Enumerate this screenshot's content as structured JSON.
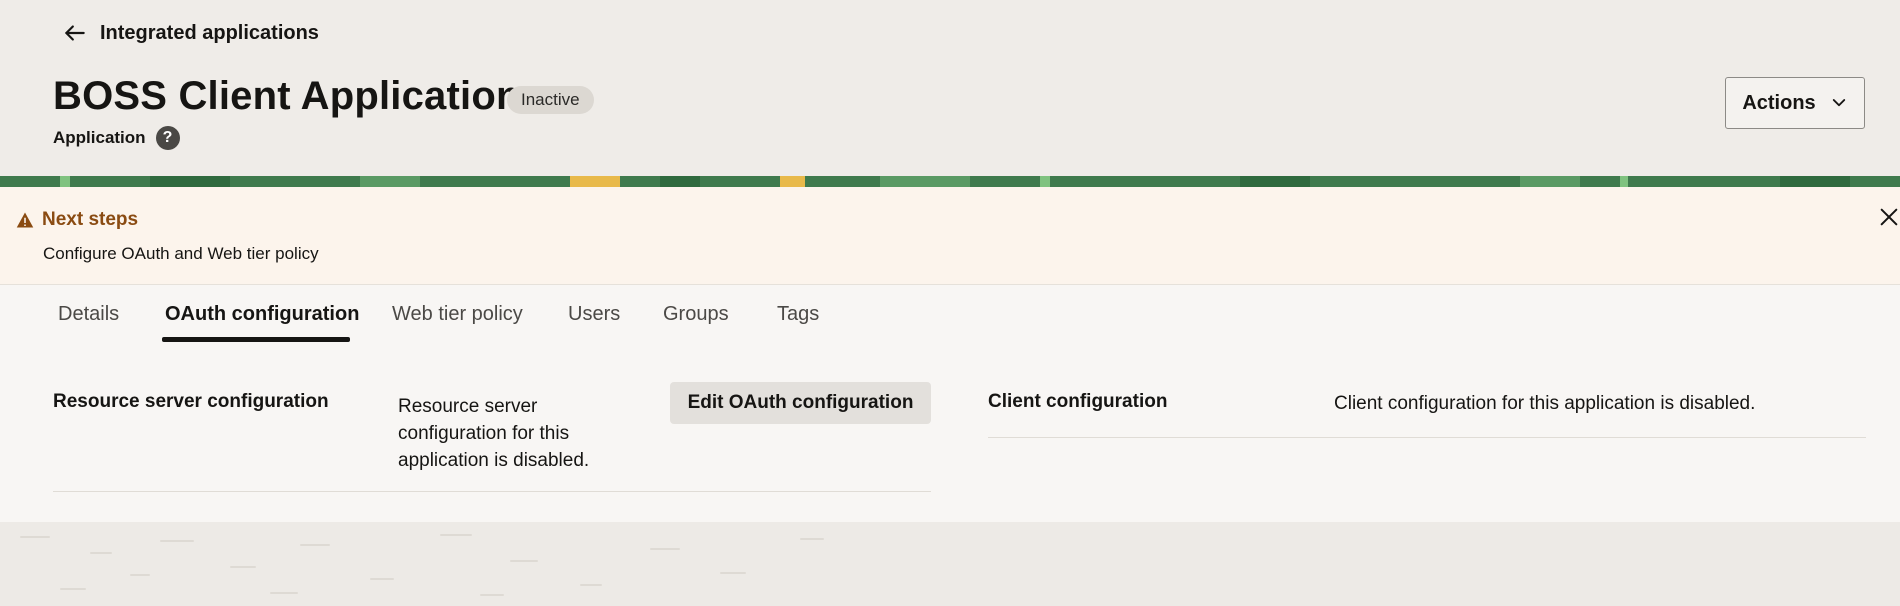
{
  "header": {
    "back_label": "Integrated applications",
    "title": "BOSS Client Application",
    "status_badge": "Inactive",
    "subtitle": "Application",
    "help_glyph": "?",
    "actions_label": "Actions"
  },
  "alert": {
    "title": "Next steps",
    "description": "Configure OAuth and Web tier policy",
    "icon": "warning-icon",
    "title_color": "#8a4b12"
  },
  "tabs": [
    {
      "label": "Details",
      "active": false
    },
    {
      "label": "OAuth configuration",
      "active": true
    },
    {
      "label": "Web tier policy",
      "active": false
    },
    {
      "label": "Users",
      "active": false
    },
    {
      "label": "Groups",
      "active": false
    },
    {
      "label": "Tags",
      "active": false
    }
  ],
  "oauth": {
    "resource_server_label": "Resource server configuration",
    "resource_server_value": "Resource server configuration for this application is disabled.",
    "edit_button_label": "Edit OAuth configuration",
    "client_label": "Client configuration",
    "client_value": "Client configuration for this application is disabled."
  },
  "colors": {
    "banner_green": "#3f7a4d",
    "banner_yellow": "#e8b94a",
    "alert_background": "#fcf4ec"
  }
}
